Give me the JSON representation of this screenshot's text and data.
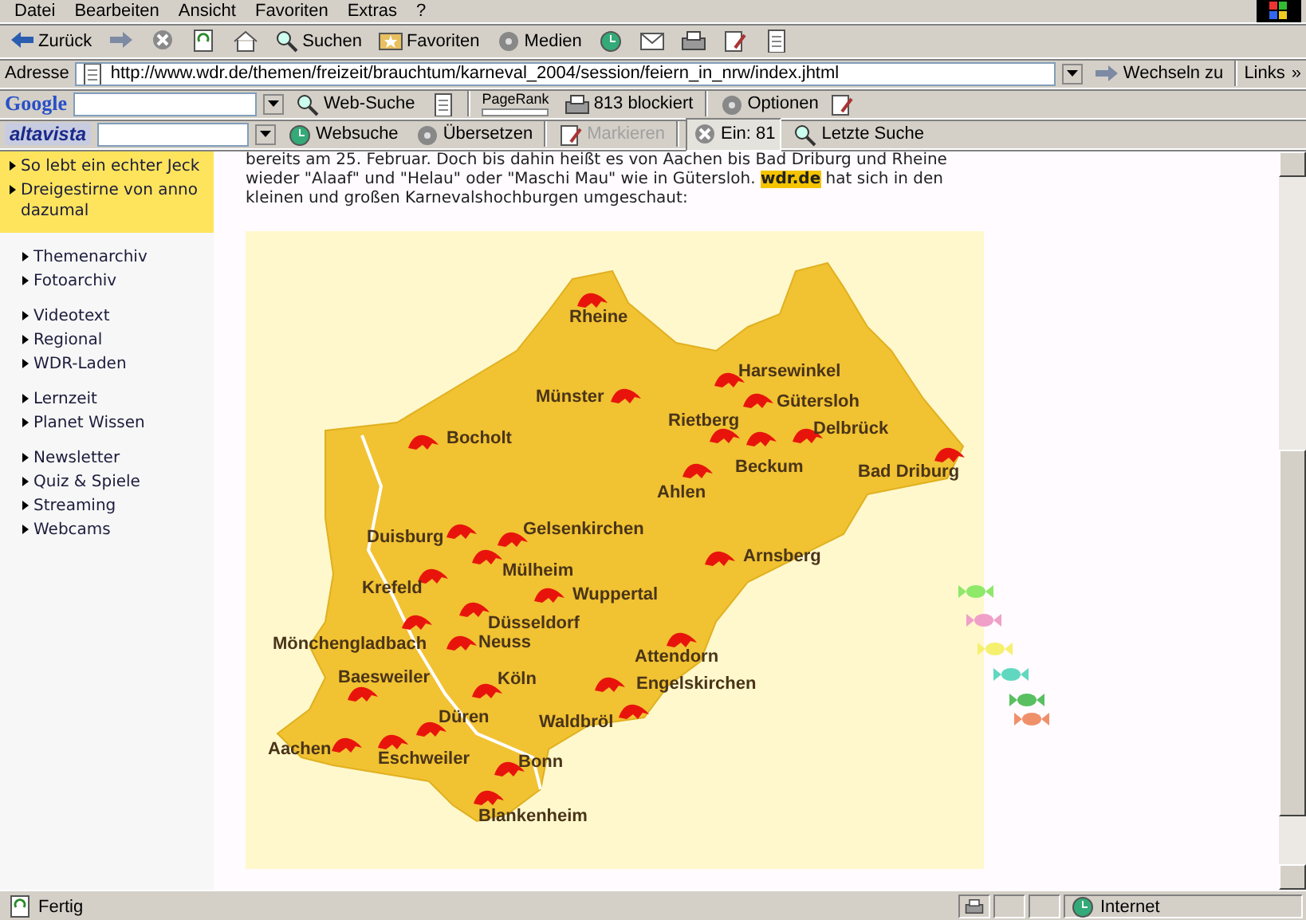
{
  "menu_bar": [
    "Datei",
    "Bearbeiten",
    "Ansicht",
    "Favoriten",
    "Extras",
    "?"
  ],
  "toolbar": [
    {
      "kind": "back",
      "label": "Zurück"
    },
    {
      "kind": "forward"
    },
    {
      "kind": "stop"
    },
    {
      "kind": "refresh"
    },
    {
      "kind": "home"
    },
    {
      "kind": "search",
      "label": "Suchen"
    },
    {
      "kind": "favorites",
      "label": "Favoriten"
    },
    {
      "kind": "media",
      "label": "Medien"
    },
    {
      "kind": "history"
    },
    {
      "kind": "mail"
    },
    {
      "kind": "print"
    },
    {
      "kind": "edit"
    },
    {
      "kind": "discuss"
    }
  ],
  "address_bar": {
    "label": "Adresse",
    "url": "http://www.wdr.de/themen/freizeit/brauchtum/karneval_2004/session/feiern_in_nrw/index.jhtml",
    "go": "Wechseln zu",
    "links": "Links",
    "more": "»"
  },
  "google_bar": {
    "logo": "Google",
    "search_button": "Web-Suche",
    "pagerank": "PageRank",
    "blocked": "813 blockiert",
    "options": "Optionen"
  },
  "altavista_bar": {
    "logo": "altavista",
    "search_button": "Websuche",
    "translate": "Übersetzen",
    "highlight": {
      "label": "Markieren",
      "disabled": true
    },
    "popup_counter": "Ein: 81",
    "last_search": "Letzte Suche"
  },
  "sidebar": {
    "featured": [
      "So lebt ein echter Jeck",
      "Dreigestirne von anno dazumal"
    ],
    "groups": [
      [
        "Themenarchiv",
        "Fotoarchiv"
      ],
      [
        "Videotext",
        "Regional",
        "WDR-Laden"
      ],
      [
        "Lernzeit",
        "Planet Wissen"
      ],
      [
        "Newsletter",
        "Quiz & Spiele",
        "Streaming",
        "Webcams"
      ]
    ]
  },
  "article": {
    "text": "bereits am 25. Februar. Doch bis dahin heißt es von Aachen bis Bad Driburg und Rheine wieder \"Alaaf\" und \"Helau\" oder \"Maschi Mau\" wie in Gütersloh. **wdr.de** hat sich in den kleinen und großen Karnevalshochburgen umgeschaut:"
  },
  "map": {
    "cities": [
      "Rheine",
      "Münster",
      "Harsewinkel",
      "Gütersloh",
      "Rietberg",
      "Delbrück",
      "Beckum",
      "Bad Driburg",
      "Ahlen",
      "Bocholt",
      "Arnsberg",
      "Duisburg",
      "Gelsenkirchen",
      "Mülheim",
      "Krefeld",
      "Wuppertal",
      "Düsseldorf",
      "Mönchengladbach",
      "Neuss",
      "Attendorn",
      "Baesweiler",
      "Köln",
      "Engelskirchen",
      "Waldbröl",
      "Düren",
      "Aachen",
      "Eschweiler",
      "Bonn",
      "Blankenheim"
    ]
  },
  "status_bar": {
    "text": "Fertig",
    "zone": "Internet"
  }
}
